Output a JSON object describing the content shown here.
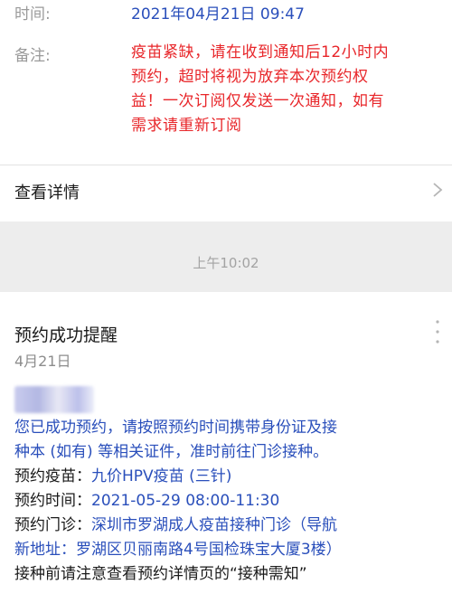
{
  "notice": {
    "time_label": "时间:",
    "time_value": "2021年04月21日 09:47",
    "remark_label": "备注:",
    "remark_lines": [
      "疫苗紧缺，请在收到通知后12小时内",
      "预约，超时将视为放弃本次预约权",
      "益！一次订阅仅发送一次通知，如有",
      "需求请重新订阅"
    ],
    "detail_link": "查看详情"
  },
  "timestamp": "上午10:02",
  "reminder": {
    "title": "预约成功提醒",
    "date": "4月21日",
    "intro_lines": [
      "您已成功预约，请按照预约时间携带身份证及接",
      "种本 (如有) 等相关证件，准时前往门诊接种。"
    ],
    "vaccine_label": "预约疫苗：",
    "vaccine_value": "九价HPV疫苗 (三针)",
    "time_label": "预约时间：",
    "time_value": "2021-05-29 08:00-11:30",
    "clinic_label": "预约门诊：",
    "clinic_value": "深圳市罗湖成人疫苗接种门诊（导航",
    "address_line": "新地址：罗湖区贝丽南路4号国检珠宝大厦3楼）",
    "footer_line": "接种前请注意查看预约详情页的“接种需知”"
  },
  "colors": {
    "accent_blue": "#2a4fbb",
    "warning_red": "#e8262a",
    "background": "#ededed"
  },
  "icons": [
    "chevron-right-icon",
    "more-vertical-icon"
  ]
}
